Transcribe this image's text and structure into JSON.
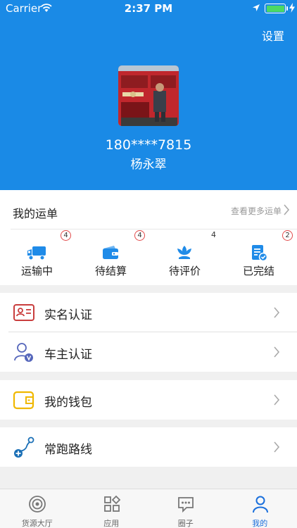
{
  "status_bar": {
    "carrier": "Carrier",
    "time": "2:37 PM"
  },
  "header": {
    "settings_label": "设置",
    "phone": "180****7815",
    "name": "杨永翠"
  },
  "orders": {
    "title": "我的运单",
    "view_more": "查看更多运单",
    "statuses": [
      {
        "label": "运输中",
        "badge": "4",
        "icon": "truck-icon"
      },
      {
        "label": "待结算",
        "badge": "4",
        "icon": "wallet-icon"
      },
      {
        "label": "待评价",
        "badge": "4",
        "icon": "flower-icon"
      },
      {
        "label": "已完结",
        "badge": "2",
        "icon": "document-check-icon"
      }
    ]
  },
  "menu": {
    "real_name": "实名认证",
    "owner_cert": "车主认证",
    "wallet": "我的钱包",
    "routes": "常跑路线"
  },
  "tabs": [
    {
      "label": "货源大厅",
      "icon": "target-icon",
      "active": false
    },
    {
      "label": "应用",
      "icon": "apps-icon",
      "active": false
    },
    {
      "label": "圈子",
      "icon": "chat-icon",
      "active": false
    },
    {
      "label": "我的",
      "icon": "person-icon",
      "active": true
    }
  ],
  "colors": {
    "primary": "#1a8ae6",
    "tab_active": "#1a6fdc",
    "badge_border": "#e14a4a"
  }
}
